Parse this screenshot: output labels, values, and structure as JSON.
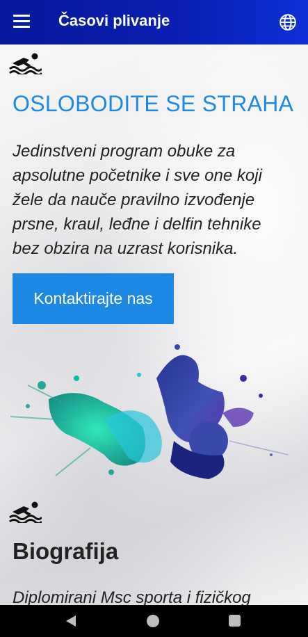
{
  "appbar": {
    "title": "Časovi plivanje",
    "menu_icon": "hamburger-menu-icon",
    "language_icon": "globe-icon",
    "color_from": "#05199c",
    "color_to": "#0e2fd6"
  },
  "hero": {
    "icon": "swimmer-icon",
    "title": "OSLOBODITE SE STRAHA",
    "text": "Jedinstveni program obuke za apsolutne početnike i sve one koji žele da nauče pravilno izvođenje prsne, kraul, leđne i delfin tehnike bez obzira na uzrast korisnika.",
    "button_label": "Kontaktirajte nas",
    "accent_color": "#1e88e5"
  },
  "illustration": {
    "name": "watercolor-swimmer-illustration"
  },
  "bio": {
    "icon": "swimmer-icon",
    "title": "Biografija",
    "text": "Diplomirani Msc sporta i fizičkog"
  },
  "system_nav": {
    "back_icon": "back-triangle-icon",
    "home_icon": "home-circle-icon",
    "recent_icon": "recent-apps-square-icon"
  }
}
